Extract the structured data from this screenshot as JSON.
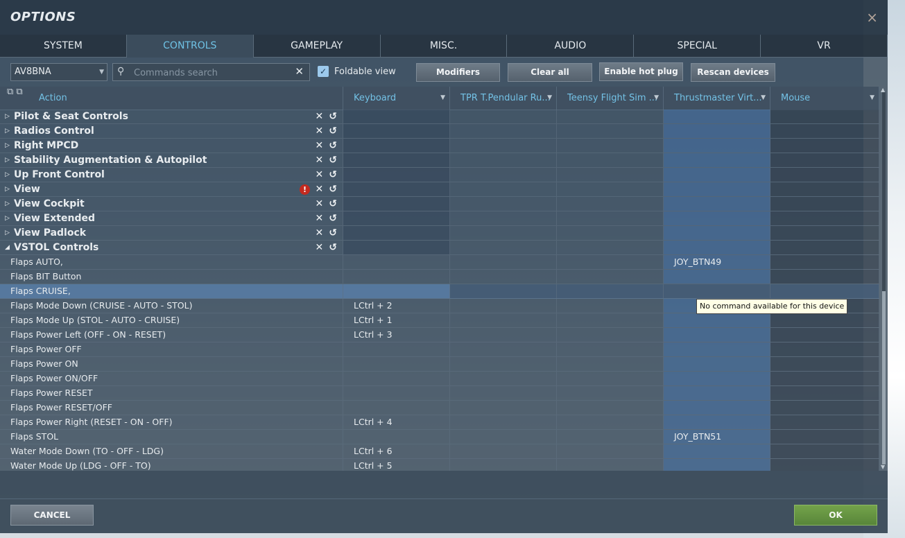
{
  "window": {
    "title": "OPTIONS",
    "close_icon": "×"
  },
  "tabs": [
    {
      "label": "SYSTEM"
    },
    {
      "label": "CONTROLS",
      "active": true
    },
    {
      "label": "GAMEPLAY"
    },
    {
      "label": "MISC."
    },
    {
      "label": "AUDIO"
    },
    {
      "label": "SPECIAL"
    },
    {
      "label": "VR"
    }
  ],
  "toolbar": {
    "aircraft": "AV8BNA",
    "search_placeholder": "Commands search",
    "foldable_label": "Foldable view",
    "modifiers": "Modifiers",
    "clear_all": "Clear all",
    "hot_plug": "Enable hot plug",
    "rescan": "Rescan devices"
  },
  "columns": [
    "Action",
    "Keyboard",
    "TPR T.Pendular Ru...",
    "Teensy Flight Sim ...",
    "Thrustmaster Virt...",
    "Mouse"
  ],
  "groups": [
    {
      "name": "Pilot & Seat Controls"
    },
    {
      "name": "Radios Control"
    },
    {
      "name": "Right MPCD"
    },
    {
      "name": "Stability Augmentation & Autopilot"
    },
    {
      "name": "Up Front Control"
    },
    {
      "name": "View",
      "warning": true
    },
    {
      "name": "View Cockpit"
    },
    {
      "name": "View Extended"
    },
    {
      "name": "View Padlock"
    },
    {
      "name": "VSTOL Controls",
      "expanded": true
    }
  ],
  "rows": [
    {
      "action": "Flaps AUTO,",
      "keyboard": "",
      "thrust": "JOY_BTN49"
    },
    {
      "action": "Flaps BIT Button",
      "keyboard": "",
      "thrust": ""
    },
    {
      "action": "Flaps CRUISE,",
      "keyboard": "",
      "thrust": "",
      "selected": true
    },
    {
      "action": "Flaps Mode Down (CRUISE - AUTO - STOL)",
      "keyboard": "LCtrl + 2",
      "thrust": ""
    },
    {
      "action": "Flaps Mode Up (STOL - AUTO - CRUISE)",
      "keyboard": "LCtrl + 1",
      "thrust": ""
    },
    {
      "action": "Flaps Power Left (OFF - ON - RESET)",
      "keyboard": "LCtrl + 3",
      "thrust": ""
    },
    {
      "action": "Flaps Power OFF",
      "keyboard": "",
      "thrust": ""
    },
    {
      "action": "Flaps Power ON",
      "keyboard": "",
      "thrust": ""
    },
    {
      "action": "Flaps Power ON/OFF",
      "keyboard": "",
      "thrust": ""
    },
    {
      "action": "Flaps Power RESET",
      "keyboard": "",
      "thrust": ""
    },
    {
      "action": "Flaps Power RESET/OFF",
      "keyboard": "",
      "thrust": ""
    },
    {
      "action": "Flaps Power Right (RESET - ON - OFF)",
      "keyboard": "LCtrl + 4",
      "thrust": ""
    },
    {
      "action": "Flaps STOL",
      "keyboard": "",
      "thrust": "JOY_BTN51"
    },
    {
      "action": "Water Mode Down (TO - OFF - LDG)",
      "keyboard": "LCtrl + 6",
      "thrust": ""
    },
    {
      "action": "Water Mode Up (LDG - OFF - TO)",
      "keyboard": "LCtrl + 5",
      "thrust": ""
    }
  ],
  "tooltip": "No command available for this device",
  "footer": {
    "cancel": "CANCEL",
    "ok": "OK"
  }
}
